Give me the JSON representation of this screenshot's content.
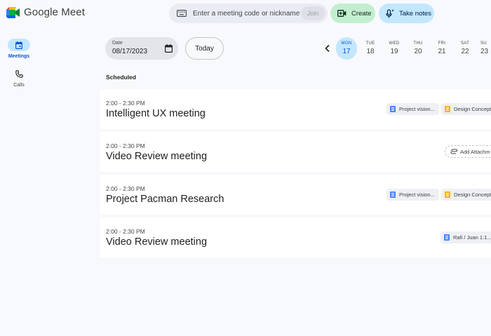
{
  "app": {
    "name": "Google Meet"
  },
  "search": {
    "placeholder": "Enter a meeting code or nickname",
    "join_label": "Join"
  },
  "actions": {
    "create_label": "Create",
    "notes_label": "Take notes"
  },
  "nav": [
    {
      "label": "Meetings",
      "icon": "calendar-icon",
      "active": true
    },
    {
      "label": "Calls",
      "icon": "phone-icon",
      "active": false
    }
  ],
  "date_picker": {
    "label": "Date",
    "value": "08/17/2023",
    "today_label": "Today"
  },
  "week": [
    {
      "day": "MON",
      "num": "17",
      "active": true
    },
    {
      "day": "TUE",
      "num": "18"
    },
    {
      "day": "WED",
      "num": "19"
    },
    {
      "day": "THU",
      "num": "20"
    },
    {
      "day": "FRI",
      "num": "21"
    },
    {
      "day": "SAT",
      "num": "22"
    },
    {
      "day": "SU",
      "num": "23"
    }
  ],
  "scheduled": {
    "heading": "Scheduled",
    "meetings": [
      {
        "time": "2:00 - 2:30 PM",
        "title": "Intelligent UX meeting",
        "chips": [
          {
            "label": "Project vision...",
            "type": "doc"
          },
          {
            "label": "Design Concept",
            "type": "slide"
          }
        ]
      },
      {
        "time": "2:00 - 2:30 PM",
        "title": "Video Review meeting",
        "chips": [
          {
            "label": "Add Attachm",
            "type": "attach"
          }
        ]
      },
      {
        "time": "2:00 - 2:30 PM",
        "title": "Project Pacman Research",
        "chips": [
          {
            "label": "Project vision...",
            "type": "doc"
          },
          {
            "label": "Design Concept",
            "type": "slide"
          }
        ]
      },
      {
        "time": "2:00 - 2:30 PM",
        "title": "Video Review meeting",
        "chips": [
          {
            "label": "Rafi / Juan 1:1...",
            "type": "doc"
          }
        ]
      }
    ]
  },
  "colors": {
    "accent": "#0b57d0",
    "selected_bg": "#c2e7ff",
    "create_bg": "#c4eed0"
  }
}
